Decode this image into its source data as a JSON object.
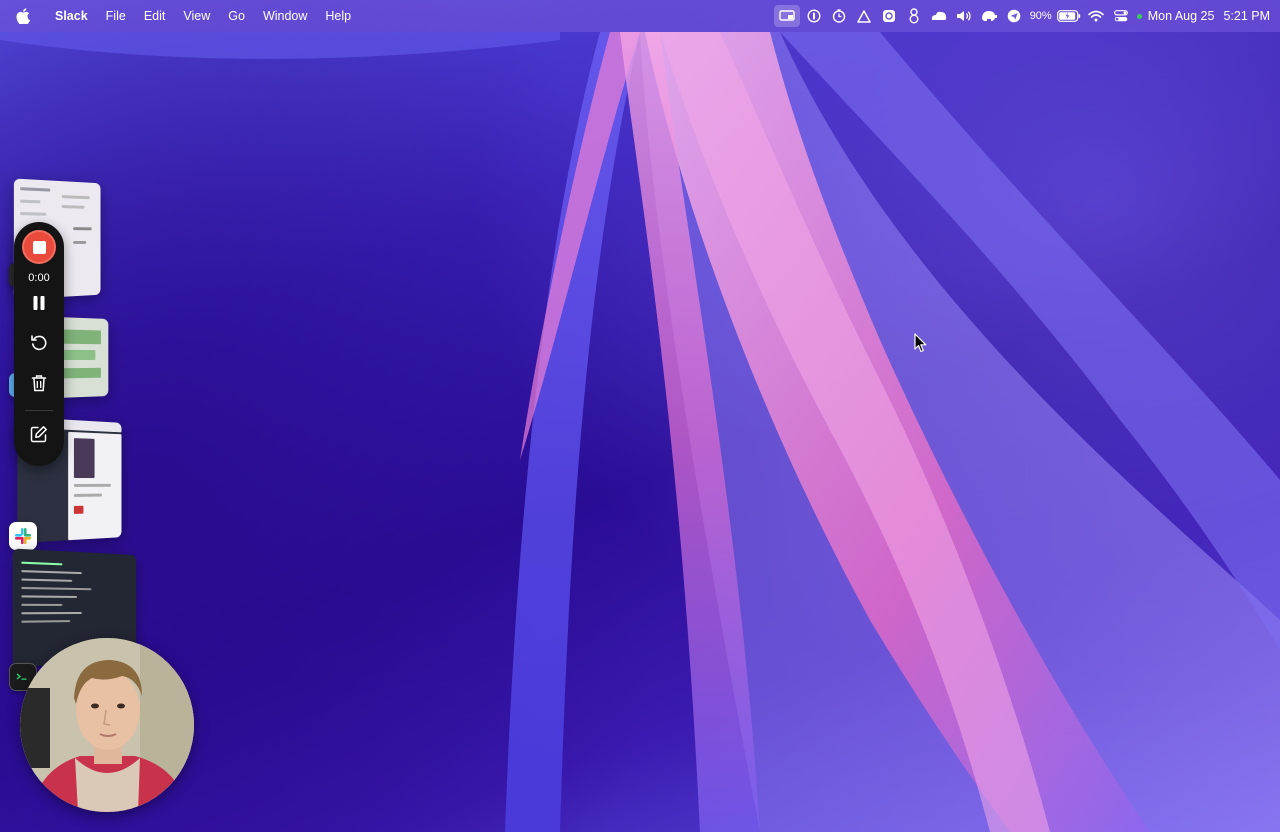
{
  "menubar": {
    "app_name": "Slack",
    "menus": [
      "File",
      "Edit",
      "View",
      "Go",
      "Window",
      "Help"
    ],
    "battery_percent": "90%",
    "date": "Mon Aug 25",
    "time": "5:21 PM",
    "status_icons": [
      "screen-mirroring-icon",
      "password-manager-icon",
      "timer-icon",
      "drive-icon",
      "vpn-icon",
      "script-icon",
      "volume-icon",
      "cloud-icon",
      "elephant-icon",
      "send-icon",
      "battery-icon",
      "wifi-icon",
      "control-center-icon"
    ]
  },
  "recording_toolbar": {
    "elapsed": "0:00",
    "buttons": [
      "stop",
      "pause",
      "restart",
      "delete",
      "annotate"
    ]
  },
  "stage_manager": {
    "apps": [
      "slack",
      "terminal"
    ]
  },
  "colors": {
    "stop_red": "#e94a3c",
    "toolbar_bg": "#141414",
    "wallpaper_pink": "#e67ad8",
    "wallpaper_blue": "#4a3fd8"
  }
}
